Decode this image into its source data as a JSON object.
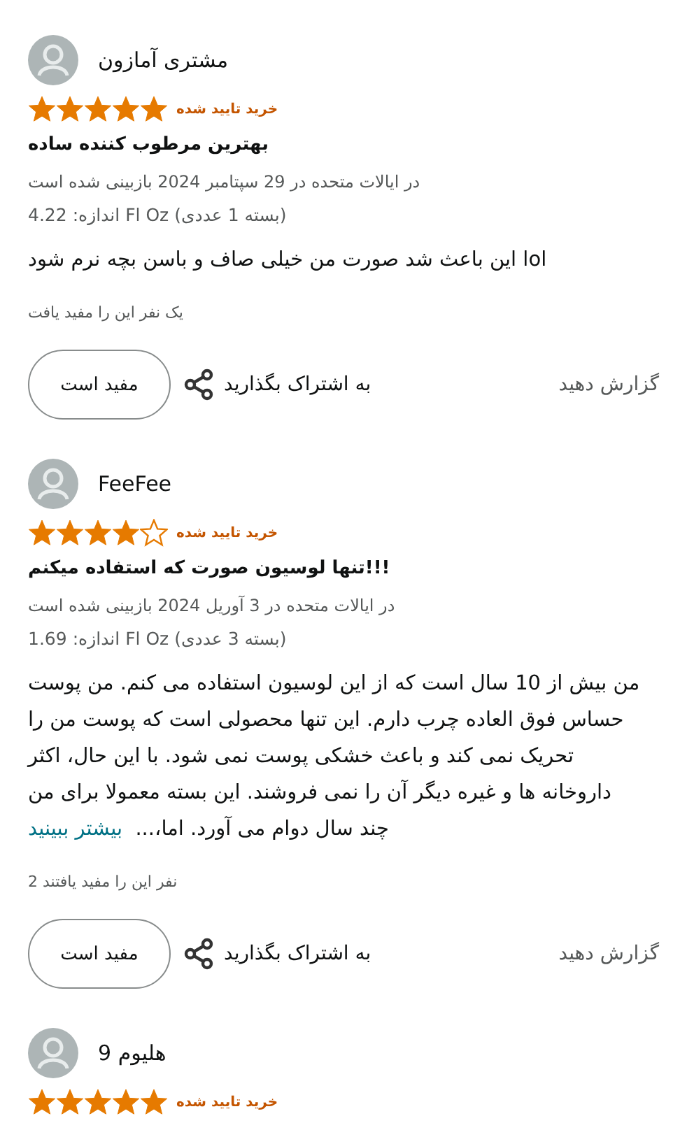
{
  "reviews": [
    {
      "author": "مشتری آمازون",
      "stars": 5,
      "verified": "خرید تایید شده",
      "title": "بهترین مرطوب کننده ساده",
      "date": "در ایالات متحده در 29 سپتامبر 2024 بازبینی شده است",
      "variant": "اندازه: 4.22 Fl Oz (بسته 1 عددی)",
      "body": "این باعث شد صورت من خیلی صاف و باسن بچه نرم شود lol",
      "helpful_count": "یک نفر این را مفید یافت",
      "helpful_button": "مفید است",
      "share": "به اشتراک بگذارید",
      "report": "گزارش دهید"
    },
    {
      "author": "FeeFee",
      "stars": 4,
      "verified": "خرید تایید شده",
      "title": "تنها لوسیون صورت که استفاده میکنم!!!",
      "date": "در ایالات متحده در 3 آوریل 2024 بازبینی شده است",
      "variant": "اندازه: 1.69 Fl Oz (بسته 3 عددی)",
      "body": "من بیش از 10 سال است که از این لوسیون استفاده می کنم. من پوست حساس فوق العاده چرب دارم. این تنها محصولی است که پوست من را تحریک نمی کند و باعث خشکی پوست نمی شود. با این حال، اکثر داروخانه ها و غیره دیگر آن را نمی فروشند. این بسته معمولا برای من چند سال دوام می آورد. اما،...",
      "more_link": "بیشتر ببینید",
      "helpful_count": "2 نفر این را مفید یافتند",
      "helpful_button": "مفید است",
      "share": "به اشتراک بگذارید",
      "report": "گزارش دهید"
    },
    {
      "author": "هلیوم 9",
      "stars": 5,
      "verified": "خرید تایید شده"
    }
  ]
}
